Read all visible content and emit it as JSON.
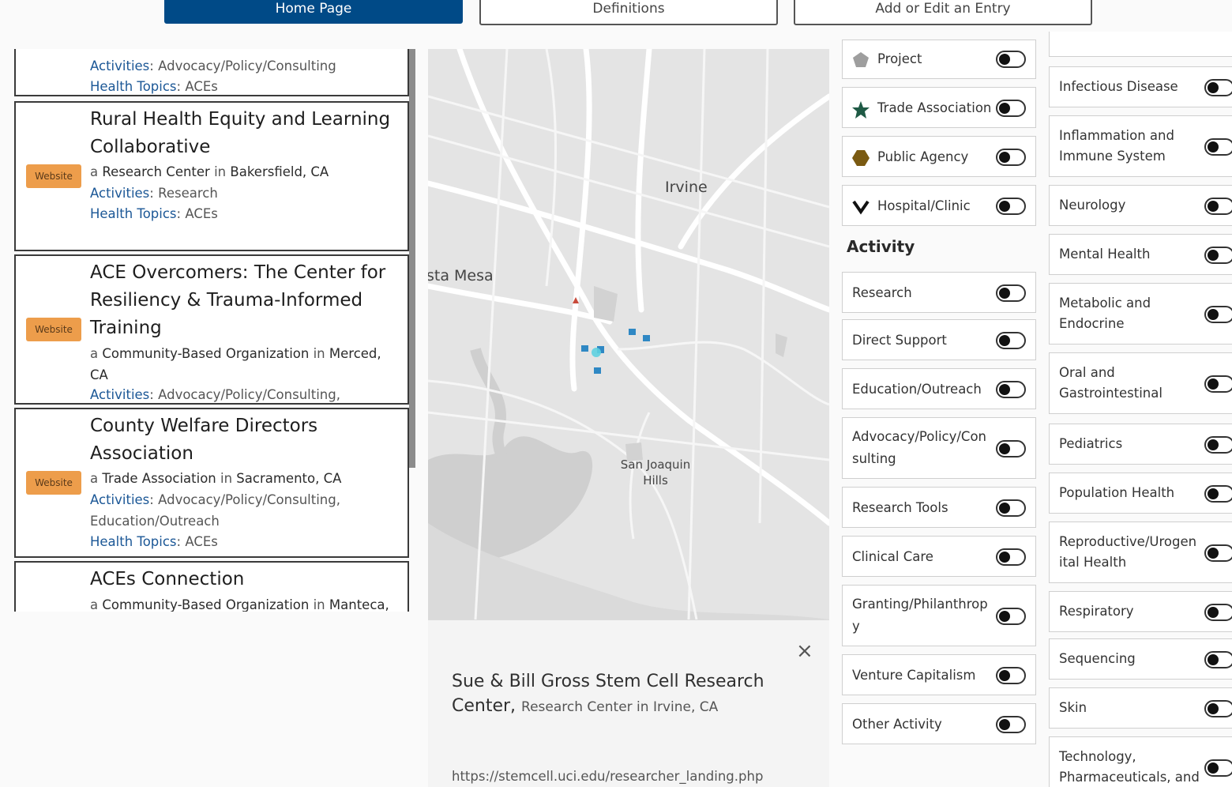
{
  "nav": {
    "home": "Home Page",
    "definitions": "Definitions",
    "add_edit": "Add or Edit an Entry"
  },
  "list": {
    "website_label": "Website",
    "partial_top": {
      "activities_label": "Activities",
      "activities": "Advocacy/Policy/Consulting",
      "topics_label": "Health Topics",
      "topics": "ACEs"
    },
    "cards": [
      {
        "title_line1": "Rural Health Equity and Learning",
        "title_line2": "Collaborative",
        "type": "Research Center",
        "location": "Bakersfield, CA",
        "activities_label": "Activities",
        "activities": "Research",
        "topics_label": "Health Topics",
        "topics": "ACEs"
      },
      {
        "title_line1": "ACE Overcomers: The Center for",
        "title_line2": "Resiliency & Trauma-Informed",
        "title_line3": "Training",
        "type": "Community-Based Organization",
        "location": "Merced,",
        "location2": "CA",
        "activities_label": "Activities",
        "activities": "Advocacy/Policy/Consulting,"
      },
      {
        "title_line1": "County Welfare Directors",
        "title_line2": "Association",
        "type": "Trade Association",
        "location": "Sacramento, CA",
        "activities_label": "Activities",
        "activities": "Advocacy/Policy/Consulting,",
        "activities2": "Education/Outreach",
        "topics_label": "Health Topics",
        "topics": "ACEs"
      },
      {
        "title_line1": "ACEs Connection",
        "type": "Community-Based Organization",
        "location": "Manteca,"
      }
    ],
    "connector_a": "a",
    "connector_in": "in",
    "colon": ":"
  },
  "map": {
    "label_irvine": "Irvine",
    "label_costa_mesa": "sta Mesa",
    "label_sjh_1": "San Joaquin",
    "label_sjh_2": "Hills"
  },
  "popup": {
    "close": "×",
    "title_line1": "Sue & Bill Gross Stem Cell Research",
    "title_line2": "Center,",
    "subtitle": "Research Center in Irvine, CA",
    "url": "https://stemcell.uci.edu/researcher_landing.php"
  },
  "org_types": [
    {
      "label": "Project",
      "icon": "pentagon-icon",
      "color": "#9e9e9e"
    },
    {
      "label": "Trade Association",
      "icon": "star-icon",
      "color": "#1f5a45"
    },
    {
      "label": "Public Agency",
      "icon": "hexagon-icon",
      "color": "#7a5a12"
    },
    {
      "label": "Hospital/Clinic",
      "icon": "chevron-down-icon",
      "color": "#111111"
    }
  ],
  "activity": {
    "heading": "Activity",
    "items": [
      [
        "Research"
      ],
      [
        "Direct Support"
      ],
      [
        "Education/Outreach"
      ],
      [
        "Advocacy/Policy/Con",
        "sulting"
      ],
      [
        "Research Tools"
      ],
      [
        "Clinical Care"
      ],
      [
        "Granting/Philanthrop",
        "y"
      ],
      [
        "Venture Capitalism"
      ],
      [
        "Other Activity"
      ]
    ]
  },
  "health_topics": [
    [
      "Infectious Disease"
    ],
    [
      "Inflammation and",
      "Immune System"
    ],
    [
      "Neurology"
    ],
    [
      "Mental Health"
    ],
    [
      "Metabolic and",
      "Endocrine"
    ],
    [
      "Oral and",
      "Gastrointestinal"
    ],
    [
      "Pediatrics"
    ],
    [
      "Population Health"
    ],
    [
      "Reproductive/Urogen",
      "ital Health"
    ],
    [
      "Respiratory"
    ],
    [
      "Sequencing"
    ],
    [
      "Skin"
    ],
    [
      "Technology,",
      "Pharmaceuticals, and"
    ]
  ]
}
